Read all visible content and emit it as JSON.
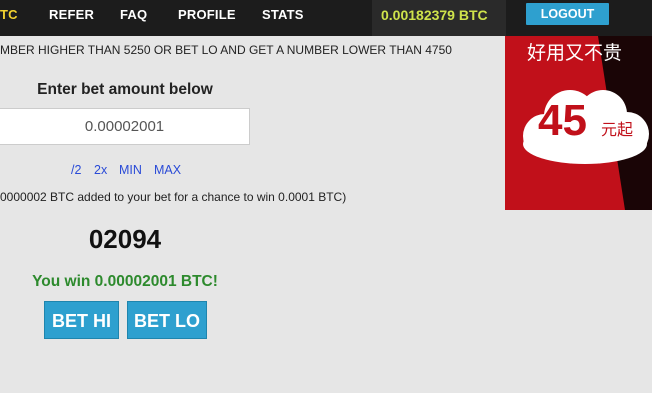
{
  "nav": {
    "btc_partial": "TC",
    "refer": "REFER",
    "faq": "FAQ",
    "profile": "PROFILE",
    "stats": "STATS",
    "balance": "0.00182379 BTC",
    "logout": "LOGOUT"
  },
  "game": {
    "rule_text": "MBER HIGHER THAN 5250 OR BET LO AND GET A NUMBER LOWER THAN 4750",
    "bet_label": "Enter bet amount below",
    "bet_amount": "0.00002001",
    "links": {
      "half": "/2",
      "double": "2x",
      "min": "MIN",
      "max": "MAX"
    },
    "jackpot_text": "0000002 BTC added to your bet for a chance to win 0.0001 BTC)",
    "roll_number": "02094",
    "win_message": "You win 0.00002001 BTC!",
    "bet_hi": "BET HI",
    "bet_lo": "BET LO"
  },
  "ad": {
    "headline": "好用又不贵",
    "price": "45",
    "suffix": "元起"
  },
  "colors": {
    "nav_bg": "#1c1c1c",
    "balance": "#cfe34b",
    "accent_button": "#2ea0cf",
    "win_text": "#2d8a2d",
    "link": "#2a4bd7",
    "ad_red": "#c1101a"
  }
}
